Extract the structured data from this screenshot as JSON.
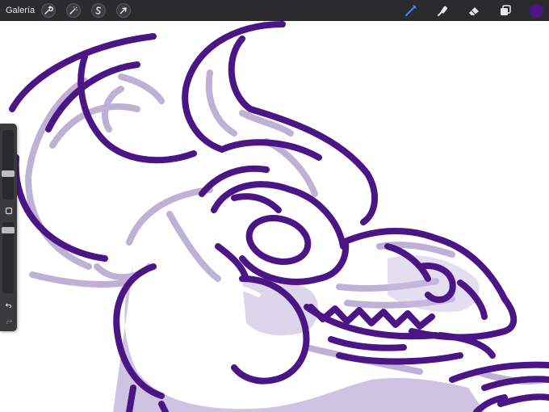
{
  "toolbar": {
    "gallery_label": "Galería",
    "left_tools": [
      {
        "icon": "wrench-icon",
        "name": "actions"
      },
      {
        "icon": "magic-wand-icon",
        "name": "adjustments"
      },
      {
        "icon": "selection-s-icon",
        "name": "selection"
      },
      {
        "icon": "arrow-cursor-icon",
        "name": "transform"
      }
    ],
    "right_tools": [
      {
        "icon": "brush-icon",
        "name": "paint",
        "active": true,
        "color": "#3a86ff"
      },
      {
        "icon": "smudge-icon",
        "name": "smudge",
        "active": false
      },
      {
        "icon": "eraser-icon",
        "name": "eraser",
        "active": false
      },
      {
        "icon": "layers-icon",
        "name": "layers",
        "active": false
      }
    ],
    "current_color": "#4b1585"
  },
  "sidebar": {
    "brush_size_level": 0.36,
    "opacity_level": 0.92,
    "modify_button_icon": "square-modify-icon",
    "undo_icon": "undo-arrow-icon",
    "redo_icon": "redo-arrow-icon"
  },
  "canvas": {
    "line_color": "#4b1585",
    "sketch_color": "#b5a3cf",
    "fill_color": "#c9bde0",
    "subject": "bull-head-sketch"
  }
}
